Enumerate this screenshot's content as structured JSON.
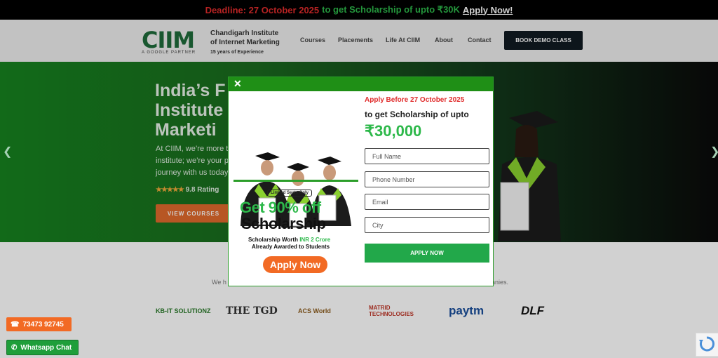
{
  "topbar": {
    "deadline": "Deadline: 27 October 2025",
    "middle": "to get Scholarship of upto ₹30K",
    "apply_link": "Apply Now!"
  },
  "header": {
    "logo_mark": "CIIM",
    "logo_sub": "A GOOGLE PARTNER",
    "logo_line1": "Chandigarh Institute",
    "logo_line2": "of Internet Marketing",
    "logo_line3": "15 years of Experience",
    "nav": [
      "Courses",
      "Placements",
      "Life At CIIM",
      "About",
      "Contact"
    ],
    "demo_button": "BOOK DEMO CLASS"
  },
  "hero": {
    "title": "India’s F\nInstitute\nMarketi",
    "desc": "At CIIM, we’re more t\ninstitute; we’re your p\njourney with us today",
    "stars": "★★★★★",
    "rating": "9.8 Rating",
    "view_button": "VIEW COURSES"
  },
  "partners": {
    "text": "We h",
    "text2": "anies.",
    "logos": [
      "KB-IT SOLUTIONZ",
      "THE TGD",
      "ACS World",
      "MATRID TECHNOLOGIES",
      "paytm",
      "DLF"
    ]
  },
  "modal": {
    "close": "✕",
    "limited": "Limited Seats Only",
    "get90": "Get 90% off",
    "scholarship": "Scholarship",
    "worth_pre": "Scholarship Worth ",
    "worth_amt": "INR 2 Crore",
    "awarded": "Already Awarded to Students",
    "apply_pill": "Apply Now",
    "before": "Apply Before 27 October 2025",
    "to_get": "to get Scholarship of upto",
    "amount": "₹30,000",
    "fields": {
      "name": "Full Name",
      "phone": "Phone Number",
      "email": "Email",
      "city": "City"
    },
    "submit": "APPLY NOW"
  },
  "floating": {
    "phone": "73473 92745",
    "whatsapp": "Whatsapp Chat"
  },
  "colors": {
    "brand_green": "#2db84a",
    "dark_green": "#1f8f16",
    "orange": "#f26a24",
    "red": "#e02b2b"
  }
}
